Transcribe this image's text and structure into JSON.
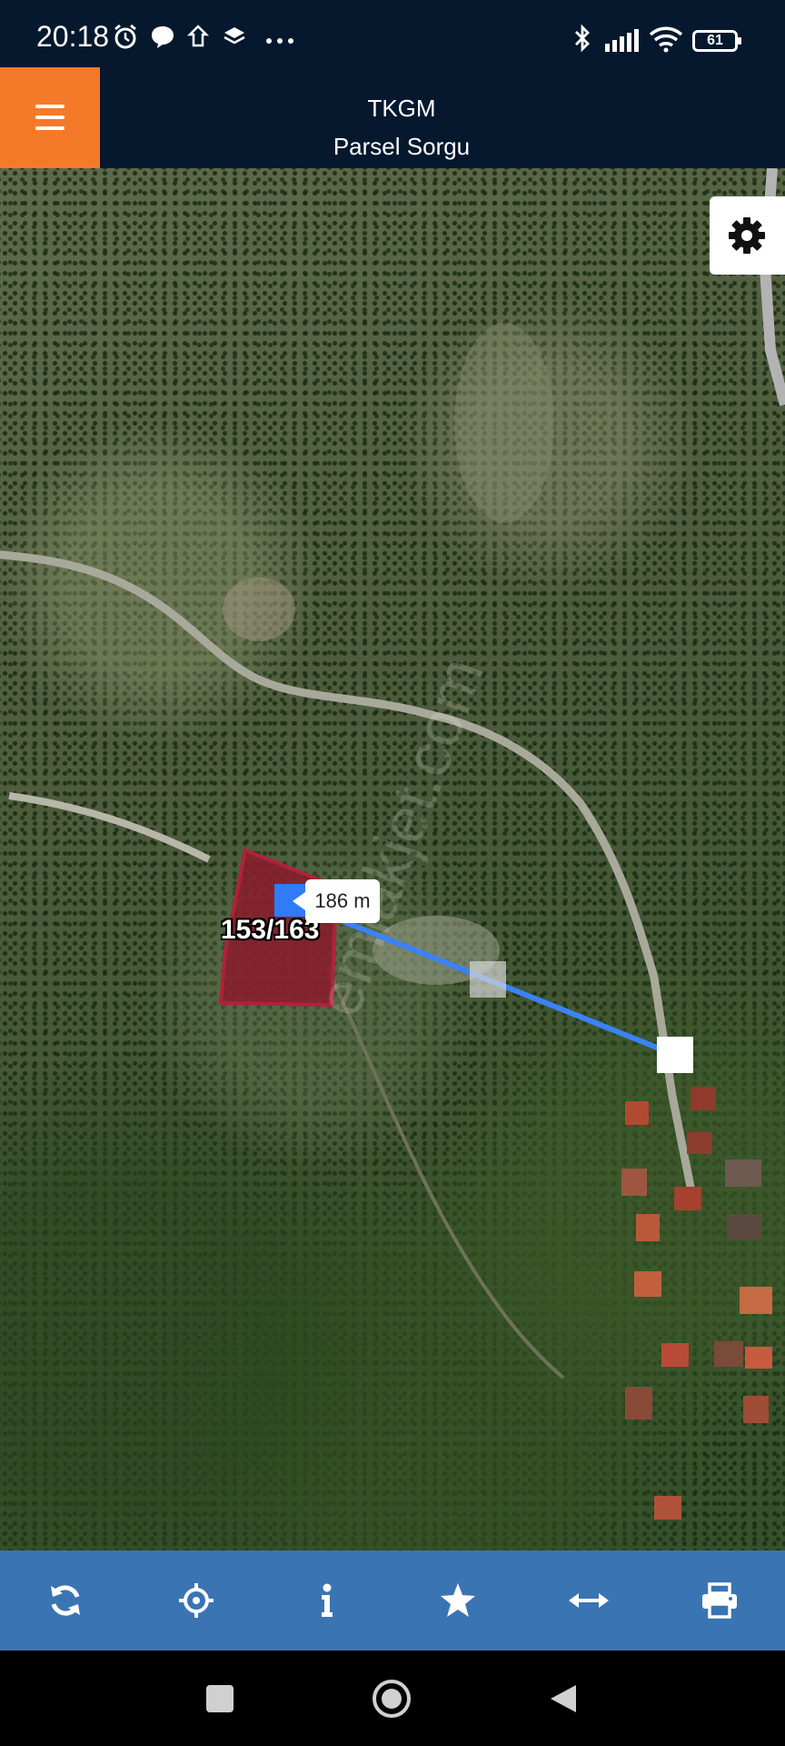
{
  "status_bar": {
    "time": "20:18",
    "battery": "61",
    "left_icons": [
      "alarm-icon",
      "chat-bubble-icon",
      "notification-icon",
      "layers-icon",
      "more-dots-icon"
    ],
    "right_icons": [
      "bluetooth-icon",
      "signal-icon",
      "wifi-icon",
      "battery-icon"
    ]
  },
  "header": {
    "title": "TKGM",
    "subtitle": "Parsel Sorgu",
    "menu_icon": "hamburger-menu-icon",
    "accent_color": "#f47a2a",
    "background_color": "#05182d"
  },
  "map": {
    "settings_icon": "gear-icon",
    "parcel": {
      "label": "153/163",
      "fill_color": "#8b1a2a"
    },
    "measurement": {
      "distance": "186 m",
      "line_color": "#3b82f6"
    },
    "watermark": "emlakjet.com"
  },
  "toolbar": {
    "background_color": "#3b74b3",
    "buttons": [
      {
        "name": "refresh",
        "icon": "refresh-icon"
      },
      {
        "name": "locate",
        "icon": "crosshair-icon"
      },
      {
        "name": "info",
        "icon": "info-icon"
      },
      {
        "name": "favorite",
        "icon": "star-icon"
      },
      {
        "name": "measure",
        "icon": "measure-arrows-icon"
      },
      {
        "name": "print",
        "icon": "printer-icon"
      }
    ]
  },
  "nav_bar": {
    "buttons": [
      "recents-square-icon",
      "home-circle-icon",
      "back-triangle-icon"
    ]
  }
}
